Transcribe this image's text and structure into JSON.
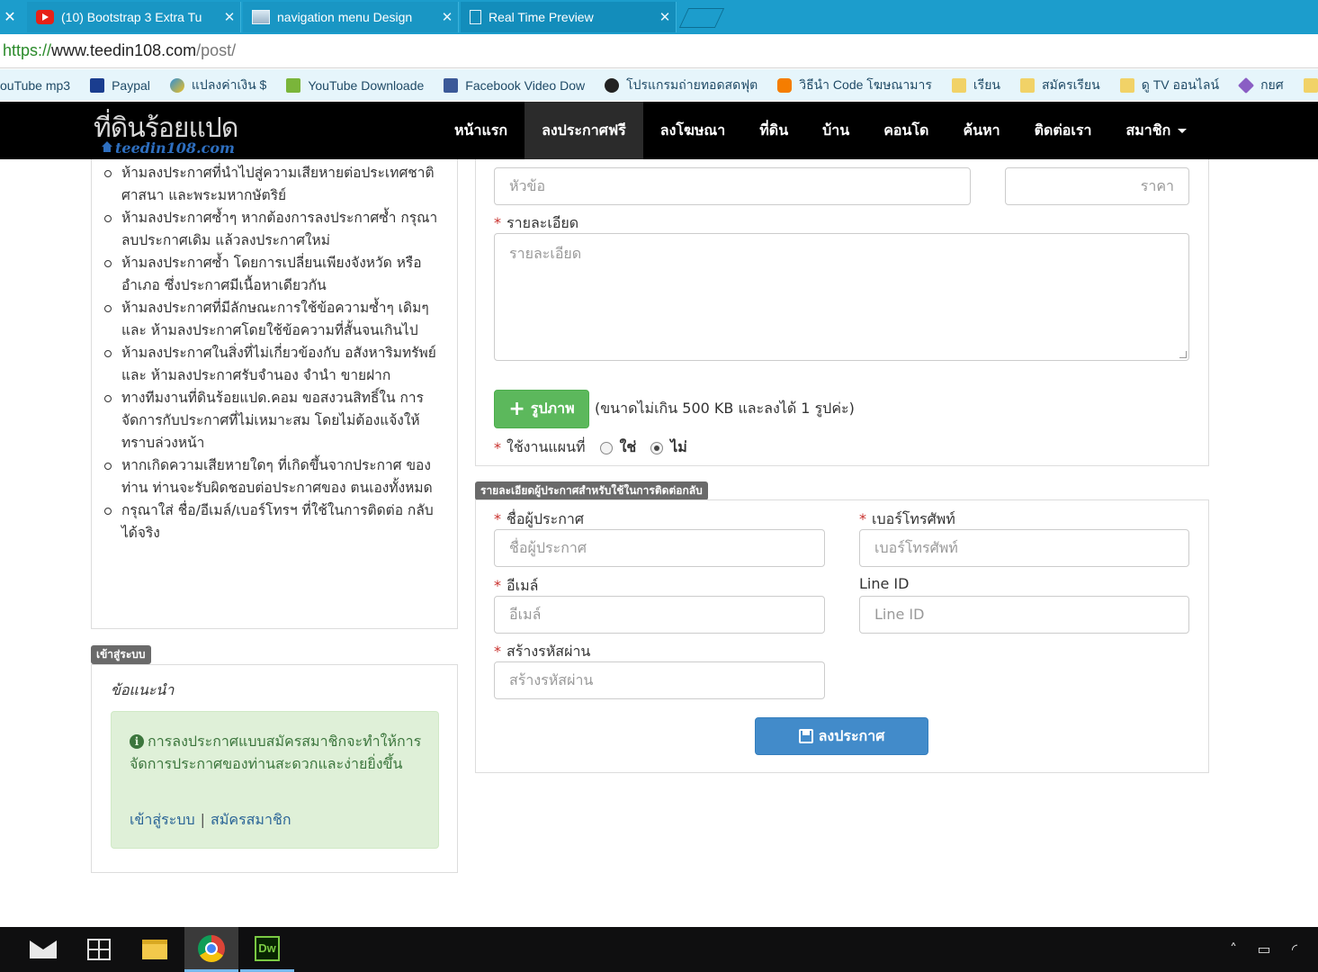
{
  "browser": {
    "tabs": [
      {
        "title": "(10) Bootstrap 3 Extra Tu",
        "icon": "youtube-icon"
      },
      {
        "title": "navigation menu Design",
        "icon": "image-icon"
      },
      {
        "title": "Real Time Preview",
        "icon": "document-icon"
      }
    ],
    "url": {
      "protocol": "https://",
      "host": "www.teedin108.com",
      "path": "/post/"
    },
    "bookmarks": [
      {
        "label": "ouTube mp3",
        "icon": "none"
      },
      {
        "label": "Paypal",
        "icon": "paypal-icon"
      },
      {
        "label": "แปลงค่าเงิน $",
        "icon": "exchange-icon"
      },
      {
        "label": "YouTube Downloade",
        "icon": "download-icon"
      },
      {
        "label": "Facebook Video Dow",
        "icon": "facebook-icon"
      },
      {
        "label": "โปรแกรมถ่ายทอดสดฟุต",
        "icon": "football-icon"
      },
      {
        "label": "วิธีนำ Code โฆษณามาร",
        "icon": "blogger-icon"
      },
      {
        "label": "เรียน",
        "icon": "folder-icon"
      },
      {
        "label": "สมัครเรียน",
        "icon": "folder-icon"
      },
      {
        "label": "ดู TV ออนไลน์",
        "icon": "folder-icon"
      },
      {
        "label": "กยศ",
        "icon": "knot-icon"
      }
    ]
  },
  "site": {
    "logo_main": "ที่ดินร้อยแปด",
    "logo_sub": "teedin108.com",
    "menu": [
      "หน้าแรก",
      "ลงประกาศฟรี",
      "ลงโฆษณา",
      "ที่ดิน",
      "บ้าน",
      "คอนโด",
      "ค้นหา",
      "ติดต่อเรา",
      "สมาชิก"
    ],
    "active_menu": "ลงประกาศฟรี"
  },
  "rules": [
    "ห้ามลงประกาศที่นำไปสู่ความเสียหายต่อประเทศชาติ ศาสนา และพระมหากษัตริย์",
    "ห้ามลงประกาศซ้ำๆ หากต้องการลงประกาศซ้ำ กรุณาลบประกาศเดิม แล้วลงประกาศใหม่",
    "ห้ามลงประกาศซ้ำ โดยการเปลี่ยนเพียงจังหวัด หรือ อำเภอ ซึ่งประกาศมีเนื้อหาเดียวกัน",
    "ห้ามลงประกาศที่มีลักษณะการใช้ข้อความซ้ำๆ เดิมๆ และ ห้ามลงประกาศโดยใช้ข้อความที่สั้นจนเกินไป",
    "ห้ามลงประกาศในสิ่งที่ไม่เกี่ยวข้องกับ อสังหาริมทรัพย์ และ ห้ามลงประกาศรับจำนอง จำนำ ขายฝาก",
    "ทางทีมงานที่ดินร้อยแปด.คอม ขอสงวนสิทธิ์ใน การจัดการกับประกาศที่ไม่เหมาะสม โดยไม่ต้องแจ้งให้ทราบล่วงหน้า",
    "หากเกิดความเสียหายใดๆ ที่เกิดขึ้นจากประกาศ ของท่าน ท่านจะรับผิดชอบต่อประกาศของ ตนเองทั้งหมด",
    "กรุณาใส่ ชื่อ/อีเมล์/เบอร์โทรฯ ที่ใช้ในการติดต่อ กลับได้จริง"
  ],
  "login_panel": {
    "badge": "เข้าสู่ระบบ",
    "title": "ข้อแนะนำ",
    "message": "การลงประกาศแบบสมัครสมาชิกจะทำให้การจัดการประกาศของท่านสะดวกและง่ายยิ่งขึ้น",
    "login_link": "เข้าสู่ระบบ",
    "separator": "|",
    "register_link": "สมัครสมาชิก"
  },
  "post_form": {
    "title_placeholder": "หัวข้อ",
    "price_placeholder": "ราคา",
    "detail_label": "รายละเอียด",
    "detail_placeholder": "รายละเอียด",
    "photo_button": "รูปภาพ",
    "photo_note": "(ขนาดไม่เกิน 500 KB และลงได้ 1 รูปค่ะ)",
    "map_label": "ใช้งานแผนที่",
    "map_yes": "ใช่",
    "map_no": "ไม่",
    "map_selected": "ไม่",
    "required_mark": "*"
  },
  "contact_form": {
    "badge": "รายละเอียดผู้ประกาศสำหรับใช้ในการติดต่อกลับ",
    "name_label": "ชื่อผู้ประกาศ",
    "name_placeholder": "ชื่อผู้ประกาศ",
    "phone_label": "เบอร์โทรศัพท์",
    "phone_placeholder": "เบอร์โทรศัพท์",
    "email_label": "อีเมล์",
    "email_placeholder": "อีเมล์",
    "line_label": "Line ID",
    "line_placeholder": "Line ID",
    "password_label": "สร้างรหัสผ่าน",
    "password_placeholder": "สร้างรหัสผ่าน",
    "submit_label": "ลงประกาศ"
  },
  "colors": {
    "accent_tabstrip": "#1c9dcc",
    "navbar": "#000000",
    "success": "#5cb85c",
    "primary": "#428bca",
    "required": "#c9302c"
  }
}
